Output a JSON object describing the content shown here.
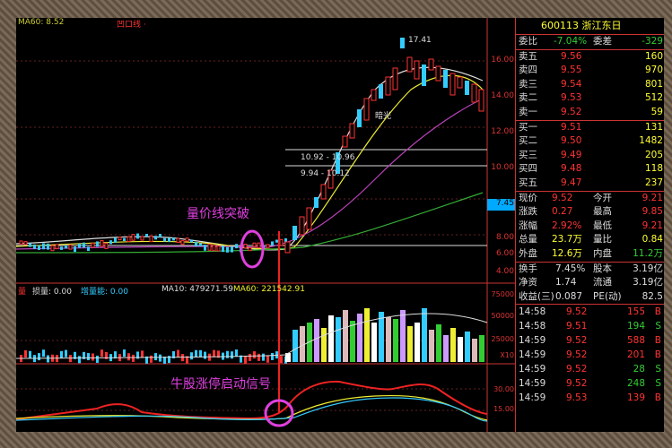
{
  "topbar": {
    "ma": "MA60: 8.52",
    "indicator": "凹口线 ·"
  },
  "price_axis": [
    "16.00",
    "14.00",
    "12.00",
    "10.00",
    "8.00",
    "6.00",
    "4.00"
  ],
  "current_price_tag": "7.45",
  "annotations": {
    "breakout": "量价线突破",
    "signal": "牛股涨停启动信号",
    "high": "17.41",
    "label_a": "10.92 - 10.96",
    "label_b": "9.94 - 10.12",
    "mark": "暗光"
  },
  "vol_bar": {
    "t1": "量",
    "t2": "损量: 0.00",
    "t3": "增量能: 0.00",
    "ma10": "MA10: 479271.59",
    "ma60": "MA60: 221542.91"
  },
  "vol_axis": [
    "75000",
    "50000",
    "25000",
    "X10"
  ],
  "ind_axis": [
    "30.00",
    "15.00"
  ],
  "quote": {
    "title": "600113 浙江东日",
    "weibi_lbl": "委比",
    "weibi": "-7.04%",
    "weicha_lbl": "委差",
    "weicha": "-329",
    "asks": [
      {
        "lbl": "卖五",
        "price": "9.56",
        "vol": "160"
      },
      {
        "lbl": "卖四",
        "price": "9.55",
        "vol": "970"
      },
      {
        "lbl": "卖三",
        "price": "9.54",
        "vol": "801"
      },
      {
        "lbl": "卖二",
        "price": "9.53",
        "vol": "512"
      },
      {
        "lbl": "卖一",
        "price": "9.52",
        "vol": "59"
      }
    ],
    "bids": [
      {
        "lbl": "买一",
        "price": "9.51",
        "vol": "131"
      },
      {
        "lbl": "买二",
        "price": "9.50",
        "vol": "1482"
      },
      {
        "lbl": "买三",
        "price": "9.49",
        "vol": "205"
      },
      {
        "lbl": "买四",
        "price": "9.48",
        "vol": "118"
      },
      {
        "lbl": "买五",
        "price": "9.47",
        "vol": "237"
      }
    ],
    "stats": [
      {
        "l1": "现价",
        "v1": "9.52",
        "l2": "今开",
        "v2": "9.21"
      },
      {
        "l1": "涨跌",
        "v1": "0.27",
        "l2": "最高",
        "v2": "9.85"
      },
      {
        "l1": "涨幅",
        "v1": "2.92%",
        "l2": "最低",
        "v2": "9.21"
      },
      {
        "l1": "总量",
        "v1": "23.7万",
        "l2": "量比",
        "v2": "0.84"
      },
      {
        "l1": "外盘",
        "v1": "12.6万",
        "l2": "内盘",
        "v2": "11.2万"
      }
    ],
    "extra": [
      {
        "l1": "换手",
        "v1": "7.45%",
        "l2": "股本",
        "v2": "3.19亿"
      },
      {
        "l1": "净资",
        "v1": "1.74",
        "l2": "流通",
        "v2": "3.19亿"
      },
      {
        "l1": "收益(三)",
        "v1": "0.087",
        "l2": "PE(动)",
        "v2": "82.5"
      }
    ],
    "trades": [
      {
        "t": "14:58",
        "p": "9.52",
        "v": "155",
        "s": "B"
      },
      {
        "t": "14:58",
        "p": "9.51",
        "v": "194",
        "s": "S"
      },
      {
        "t": "14:59",
        "p": "9.52",
        "v": "588",
        "s": "B"
      },
      {
        "t": "14:59",
        "p": "9.52",
        "v": "201",
        "s": "B"
      },
      {
        "t": "14:59",
        "p": "9.52",
        "v": "28",
        "s": "S"
      },
      {
        "t": "14:59",
        "p": "9.52",
        "v": "248",
        "s": "S"
      },
      {
        "t": "14:59",
        "p": "9.53",
        "v": "139",
        "s": "B"
      }
    ]
  }
}
